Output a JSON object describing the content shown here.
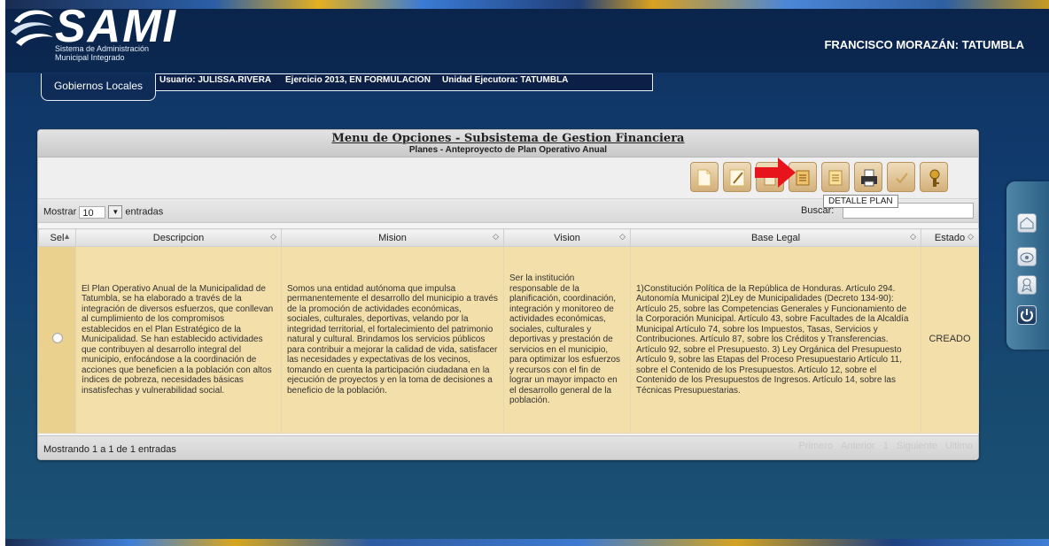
{
  "app": {
    "logo": "SAMI",
    "logo_sub_1": "Sistema de Administración",
    "logo_sub_2": "Municipal Integrado",
    "org_title": "FRANCISCO MORAZÁN: TATUMBLA"
  },
  "nav": {
    "tab": "Gobiernos Locales",
    "usuario": "Usuario: JULISSA.RIVERA",
    "ejercicio": "Ejercicio 2013, EN FORMULACION",
    "unidad": "Unidad Ejecutora: TATUMBLA"
  },
  "panel": {
    "title": "Menu de Opciones - Subsistema de Gestion Financiera",
    "subtitle": "Planes - Anteproyecto de Plan Operativo Anual",
    "tooltip": "DETALLE PLAN",
    "toolbar_icons": [
      "new-document-icon",
      "edit-icon",
      "delete-icon",
      "detalle-plan-icon",
      "list-icon",
      "print-icon",
      "approve-icon",
      "key-icon"
    ]
  },
  "table_controls": {
    "show_label": "Mostrar",
    "page_size": "10",
    "entries_label": "entradas",
    "search_label": "Buscar:",
    "search_value": ""
  },
  "table": {
    "columns": [
      "Sel",
      "Descripcion",
      "Mision",
      "Vision",
      "Base Legal",
      "Estado"
    ],
    "rows": [
      {
        "descripcion": "El Plan Operativo Anual de la Municipalidad de Tatumbla, se ha elaborado a través de la integración de diversos esfuerzos, que conllevan al cumplimiento de los compromisos establecidos en el Plan Estratégico de la Municipalidad. Se han establecido actividades que contribuyen al desarrollo integral del municipio, enfocándose a la coordinación de acciones que beneficien a la población con altos índices de pobreza, necesidades básicas insatisfechas y vulnerabilidad social.",
        "mision": "Somos una entidad autónoma que impulsa permanentemente el desarrollo del municipio a través de la promoción de actividades económicas, sociales, culturales, deportivas, velando por la integridad territorial, el fortalecimiento del patrimonio natural y cultural. Brindamos los servicios públicos para contribuir a mejorar la calidad de vida, satisfacer las necesidades y expectativas de los vecinos, tomando en cuenta la participación ciudadana en la ejecución de proyectos y en la toma de decisiones a beneficio de la población.",
        "vision": "Ser la institución responsable de la planificación, coordinación, integración y monitoreo de actividades económicas, sociales, culturales y deportivas y prestación de servicios en el municipio, para optimizar los esfuerzos y recursos con el fin de lograr un mayor impacto en el desarrollo general de la población.",
        "base_legal": "1)Constitución Política de la República de Honduras. Artículo 294. Autonomía Municipal 2)Ley de Municipalidades (Decreto 134-90): Artículo 25, sobre las Competencias Generales y Funcionamiento de la Corporación Municipal. Artículo 43, sobre Facultades de la Alcaldía Municipal Artículo 74, sobre los Impuestos, Tasas, Servicios y Contribuciones. Artículo 87, sobre los Créditos y Transferencias. Artículo 92, sobre el Presupuesto. 3) Ley Orgánica del Presupuesto Artículo 9, sobre las Etapas del Proceso Presupuestario Artículo 11, sobre el Contenido de los Presupuestos. Artículo 12, sobre el Contenido de los Presupuestos de Ingresos. Artículo 14, sobre las Técnicas Presupuestarias.",
        "estado": "CREADO"
      }
    ]
  },
  "footer": {
    "info": "Mostrando 1 a 1 de 1 entradas",
    "pager": [
      "Primero",
      "Anterior",
      "1",
      "Siguiente",
      "Ultimo"
    ]
  },
  "dock_icons": [
    "home-icon",
    "network-icon",
    "ribbon-icon",
    "power-icon"
  ],
  "colors": {
    "background": "#123f73",
    "row_background": "#f3dfaa",
    "toolbar_button": "#d9b884",
    "arrow": "#e8141b"
  }
}
